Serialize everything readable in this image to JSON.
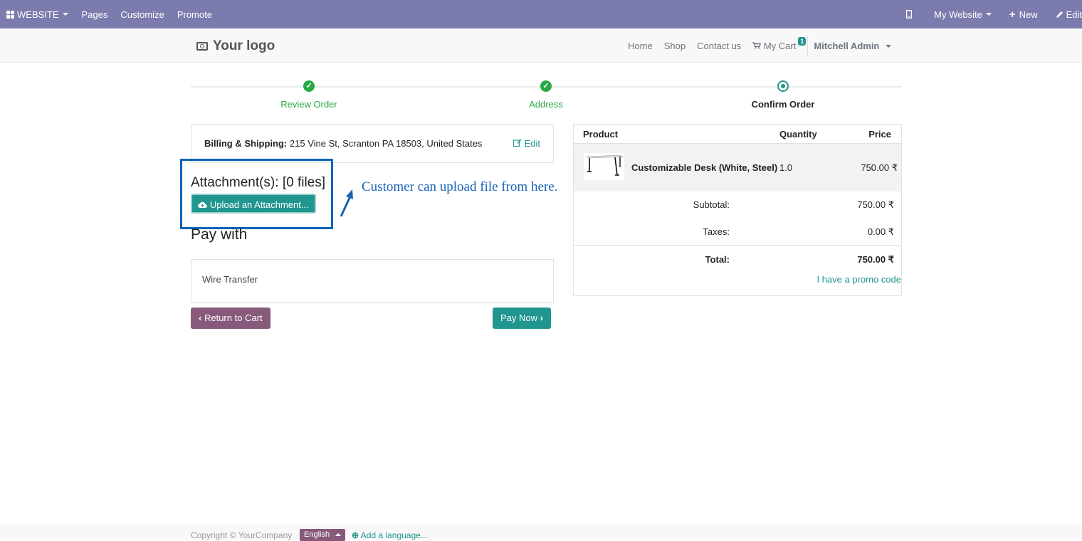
{
  "adminbar": {
    "website_label": "WEBSITE",
    "pages": "Pages",
    "customize": "Customize",
    "promote": "Promote",
    "my_website": "My Website",
    "new": "New",
    "edit": "Edit",
    "color": "#7c7bad"
  },
  "navbar": {
    "logo": "Your logo",
    "links": [
      "Home",
      "Shop",
      "Contact us"
    ],
    "cart_label": "My Cart",
    "cart_count": "1",
    "user": "Mitchell Admin"
  },
  "wizard": {
    "steps": [
      {
        "label": "Review Order",
        "state": "done"
      },
      {
        "label": "Address",
        "state": "done"
      },
      {
        "label": "Confirm Order",
        "state": "current"
      }
    ]
  },
  "billing": {
    "label": "Billing & Shipping:",
    "address": "215 Vine St, Scranton PA 18503, United States",
    "edit": "Edit"
  },
  "attachments": {
    "title": "Attachment(s): [0 files]",
    "upload_button": "Upload an Attachment..."
  },
  "annotation": "Customer can upload file from here.",
  "payment": {
    "title": "Pay with",
    "method": "Wire Transfer",
    "return_button": "Return to Cart",
    "pay_button": "Pay Now"
  },
  "summary": {
    "headers": {
      "product": "Product",
      "quantity": "Quantity",
      "price": "Price"
    },
    "line": {
      "name": "Customizable Desk (White, Steel)",
      "qty": "1.0",
      "price": "750.00 ₹"
    },
    "subtotal_label": "Subtotal:",
    "subtotal": "750.00 ₹",
    "taxes_label": "Taxes:",
    "taxes": "0.00 ₹",
    "total_label": "Total:",
    "total": "750.00 ₹",
    "promo": "I have a promo code"
  },
  "footer": {
    "copyright": "Copyright © YourCompany",
    "language": "English",
    "add_language": "Add a language..."
  },
  "colors": {
    "primary": "#21968e",
    "secondary": "#875a7b",
    "success": "#28a745",
    "annotation": "#0a63b8"
  }
}
